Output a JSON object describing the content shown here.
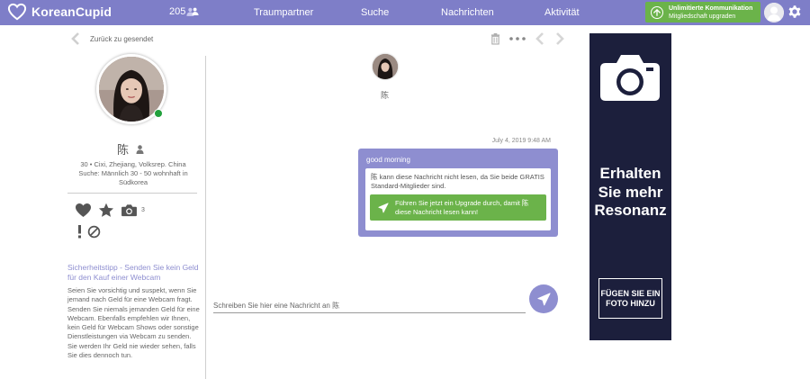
{
  "header": {
    "logo_text": "KoreanCupid",
    "match_count": "205",
    "nav": [
      "Traumpartner",
      "Suche",
      "Nachrichten",
      "Aktivität"
    ],
    "upgrade_line1": "Unlimitierte Kommunikation",
    "upgrade_line2": "Mitgliedschaft upgraden"
  },
  "subheader": {
    "back_label": "Zurück zu gesendet"
  },
  "profile": {
    "name": "陈",
    "location": "30 • Cixi, Zhejiang, Volksrep. China",
    "seeking": "Suche: Männlich 30 - 50 wohnhaft in Südkorea",
    "photo_count": "3",
    "online_color": "#22a03c"
  },
  "safety_tip": {
    "title": "Sicherheitstipp - Senden Sie kein Geld für den Kauf einer Webcam",
    "body": "Seien Sie vorsichtig und suspekt, wenn Sie jemand nach Geld für eine Webcam fragt. Senden Sie niemals jemanden Geld für eine Webcam. Ebenfalls empfehlen wir Ihnen, kein Geld für Webcam Shows oder sonstige Dienstleistungen via Webcam zu senden. Sie werden Ihr Geld nie wieder sehen, falls Sie dies dennoch tun."
  },
  "conversation": {
    "contact_name": "陈",
    "timestamp": "July 4, 2019 9:48 AM",
    "message_text": "good morning",
    "notice_text": "陈 kann diese Nachricht nicht lesen, da Sie beide GRATIS Standard-Mitglieder sind.",
    "upgrade_cta": "Führen Sie jetzt ein Upgrade durch, damit 陈 diese Nachricht lesen kann!",
    "compose_placeholder": "Schreiben Sie hier eine Nachricht an 陈"
  },
  "ad": {
    "headline": "Erhalten Sie mehr Resonanz",
    "cta": "FÜGEN SIE EIN FOTO HINZU"
  },
  "colors": {
    "brand": "#7e7ec8",
    "accent": "#8e8ed0",
    "upgrade_green": "#6bb34a",
    "ad_bg": "#1c1f3c"
  },
  "icons": [
    "heart-logo-icon",
    "matches-people-icon",
    "arrow-up-circle-icon",
    "gear-icon",
    "chevron-left-icon",
    "trash-icon",
    "more-dots-icon",
    "chevron-right-icon",
    "user-icon",
    "heart-icon",
    "star-icon",
    "camera-icon",
    "report-icon",
    "block-icon",
    "send-icon"
  ]
}
